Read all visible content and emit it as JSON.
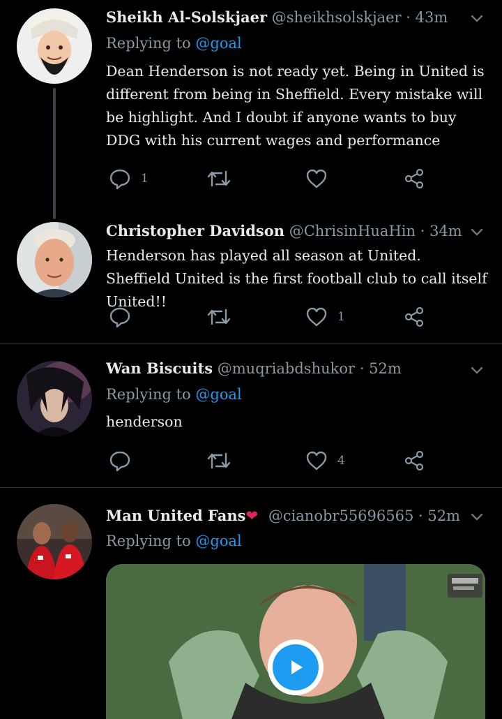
{
  "tweets": [
    {
      "name": "Sheikh Al-Solskjaer",
      "handle": "@sheikhsolskjaer",
      "time": "43m",
      "reply_label": "Replying to",
      "reply_to": "@goal",
      "text": "Dean Henderson is not ready yet. Being in United is different from being in Sheffield. Every mistake will be highlight. And I doubt if anyone wants to buy DDG with his current wages and performance",
      "reply_count": "1",
      "retweet_count": "",
      "like_count": "",
      "avatar": "avatar-bearded-man-white-turban"
    },
    {
      "name": "Christopher Davidson",
      "handle": "@ChrisinHuaHin",
      "time": "34m",
      "text": "Henderson has played all season at United. Sheffield United is the first football club to call itself United!!",
      "reply_count": "",
      "retweet_count": "",
      "like_count": "1",
      "avatar": "avatar-older-man"
    },
    {
      "name": "Wan Biscuits",
      "handle": "@muqriabdshukor",
      "time": "52m",
      "reply_label": "Replying to",
      "reply_to": "@goal",
      "text": "henderson",
      "reply_count": "",
      "retweet_count": "",
      "like_count": "4",
      "avatar": "avatar-anime-character"
    },
    {
      "name": "Man United Fans",
      "name_emoji": "❤",
      "handle": "@cianobr55696565",
      "time": "52m",
      "reply_label": "Replying to",
      "reply_to": "@goal",
      "media": "video-goalkeeper-hands-to-ears",
      "avatar": "avatar-two-footballers-red-kit"
    }
  ],
  "colors": {
    "background": "#000000",
    "text": "#e7e9ea",
    "muted": "#8b98a5",
    "link": "#1d9bf0",
    "divider": "#2f3336",
    "heart": "#e0245e",
    "play": "#1d9bf0"
  },
  "icons": {
    "reply": "reply-icon",
    "retweet": "retweet-icon",
    "like": "heart-icon",
    "share": "share-icon",
    "more": "chevron-down-icon",
    "play": "play-icon"
  }
}
